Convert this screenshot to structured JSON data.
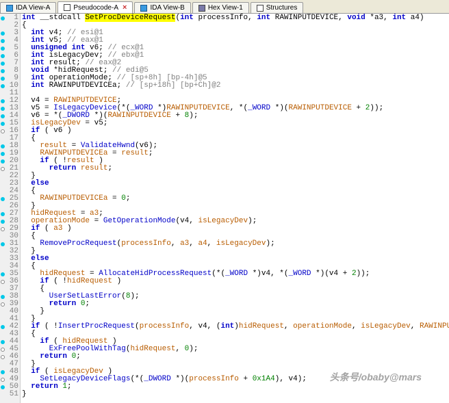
{
  "tabs": [
    {
      "label": "IDA View-A",
      "icon": "ic-square",
      "active": false
    },
    {
      "label": "Pseudocode-A",
      "icon": "ic-box",
      "active": true,
      "closable": true
    },
    {
      "label": "IDA View-B",
      "icon": "ic-square",
      "active": false
    },
    {
      "label": "Hex View-1",
      "icon": "ic-hex",
      "active": false
    },
    {
      "label": "Structures",
      "icon": "ic-struct",
      "active": false
    }
  ],
  "code_lines": [
    {
      "n": 1,
      "b": "cyan",
      "seg": [
        {
          "t": "int",
          "c": "kw"
        },
        {
          "t": " __stdcall "
        },
        {
          "t": "SetProcDeviceRequest",
          "c": "hl"
        },
        {
          "t": "("
        },
        {
          "t": "int",
          "c": "kw"
        },
        {
          "t": " processInfo, "
        },
        {
          "t": "int",
          "c": "kw"
        },
        {
          "t": " RAWINPUTDEVICE, "
        },
        {
          "t": "void",
          "c": "kw"
        },
        {
          "t": " *a3, "
        },
        {
          "t": "int",
          "c": "kw"
        },
        {
          "t": " a4)"
        }
      ]
    },
    {
      "n": 2,
      "seg": [
        {
          "t": "{"
        }
      ]
    },
    {
      "n": 3,
      "b": "cyan",
      "seg": [
        {
          "t": "  "
        },
        {
          "t": "int",
          "c": "kw"
        },
        {
          "t": " v4; "
        },
        {
          "t": "// esi@1",
          "c": "cmt"
        }
      ]
    },
    {
      "n": 4,
      "b": "cyan",
      "seg": [
        {
          "t": "  "
        },
        {
          "t": "int",
          "c": "kw"
        },
        {
          "t": " v5; "
        },
        {
          "t": "// eax@1",
          "c": "cmt"
        }
      ]
    },
    {
      "n": 5,
      "b": "cyan",
      "seg": [
        {
          "t": "  "
        },
        {
          "t": "unsigned",
          "c": "kw"
        },
        {
          "t": " "
        },
        {
          "t": "int",
          "c": "kw"
        },
        {
          "t": " v6; "
        },
        {
          "t": "// ecx@1",
          "c": "cmt"
        }
      ]
    },
    {
      "n": 6,
      "b": "cyan",
      "seg": [
        {
          "t": "  "
        },
        {
          "t": "int",
          "c": "kw"
        },
        {
          "t": " isLegacyDev; "
        },
        {
          "t": "// ebx@1",
          "c": "cmt"
        }
      ]
    },
    {
      "n": 7,
      "b": "cyan",
      "seg": [
        {
          "t": "  "
        },
        {
          "t": "int",
          "c": "kw"
        },
        {
          "t": " result; "
        },
        {
          "t": "// eax@2",
          "c": "cmt"
        }
      ]
    },
    {
      "n": 8,
      "b": "cyan",
      "seg": [
        {
          "t": "  "
        },
        {
          "t": "void",
          "c": "kw"
        },
        {
          "t": " *hidRequest; "
        },
        {
          "t": "// edi@5",
          "c": "cmt"
        }
      ]
    },
    {
      "n": 9,
      "b": "cyan",
      "seg": [
        {
          "t": "  "
        },
        {
          "t": "int",
          "c": "kw"
        },
        {
          "t": " operationMode; "
        },
        {
          "t": "// [sp+8h] [bp-4h]@5",
          "c": "cmt"
        }
      ]
    },
    {
      "n": 10,
      "b": "cyan",
      "seg": [
        {
          "t": "  "
        },
        {
          "t": "int",
          "c": "kw"
        },
        {
          "t": " RAWINPUTDEVICEa; "
        },
        {
          "t": "// [sp+18h] [bp+Ch]@2",
          "c": "cmt"
        }
      ]
    },
    {
      "n": 11,
      "seg": [
        {
          "t": ""
        }
      ]
    },
    {
      "n": 12,
      "b": "cyan",
      "seg": [
        {
          "t": "  v4 = "
        },
        {
          "t": "RAWINPUTDEVICE",
          "c": "id"
        },
        {
          "t": ";"
        }
      ]
    },
    {
      "n": 13,
      "b": "cyan",
      "seg": [
        {
          "t": "  v5 = "
        },
        {
          "t": "IsLegacyDevice",
          "c": "fn"
        },
        {
          "t": "(*("
        },
        {
          "t": "_WORD",
          "c": "ty"
        },
        {
          "t": " *)"
        },
        {
          "t": "RAWINPUTDEVICE",
          "c": "id"
        },
        {
          "t": ", *("
        },
        {
          "t": "_WORD",
          "c": "ty"
        },
        {
          "t": " *)("
        },
        {
          "t": "RAWINPUTDEVICE",
          "c": "id"
        },
        {
          "t": " + "
        },
        {
          "t": "2",
          "c": "num"
        },
        {
          "t": "));"
        }
      ]
    },
    {
      "n": 14,
      "b": "cyan",
      "seg": [
        {
          "t": "  v6 = *("
        },
        {
          "t": "_DWORD",
          "c": "ty"
        },
        {
          "t": " *)("
        },
        {
          "t": "RAWINPUTDEVICE",
          "c": "id"
        },
        {
          "t": " + "
        },
        {
          "t": "8",
          "c": "num"
        },
        {
          "t": ");"
        }
      ]
    },
    {
      "n": 15,
      "b": "cyan",
      "seg": [
        {
          "t": "  "
        },
        {
          "t": "isLegacyDev",
          "c": "id"
        },
        {
          "t": " = v5;"
        }
      ]
    },
    {
      "n": 16,
      "b": "white",
      "seg": [
        {
          "t": "  "
        },
        {
          "t": "if",
          "c": "kw"
        },
        {
          "t": " ( v6 )"
        }
      ]
    },
    {
      "n": 17,
      "seg": [
        {
          "t": "  {"
        }
      ]
    },
    {
      "n": 18,
      "b": "cyan",
      "seg": [
        {
          "t": "    "
        },
        {
          "t": "result",
          "c": "id"
        },
        {
          "t": " = "
        },
        {
          "t": "ValidateHwnd",
          "c": "fn"
        },
        {
          "t": "(v6);"
        }
      ]
    },
    {
      "n": 19,
      "b": "cyan",
      "seg": [
        {
          "t": "    "
        },
        {
          "t": "RAWINPUTDEVICEa",
          "c": "id"
        },
        {
          "t": " = "
        },
        {
          "t": "result",
          "c": "id"
        },
        {
          "t": ";"
        }
      ]
    },
    {
      "n": 20,
      "b": "cyan",
      "seg": [
        {
          "t": "    "
        },
        {
          "t": "if",
          "c": "kw"
        },
        {
          "t": " ( !"
        },
        {
          "t": "result",
          "c": "id"
        },
        {
          "t": " )"
        }
      ]
    },
    {
      "n": 21,
      "b": "white",
      "seg": [
        {
          "t": "      "
        },
        {
          "t": "return",
          "c": "kw"
        },
        {
          "t": " "
        },
        {
          "t": "result",
          "c": "id"
        },
        {
          "t": ";"
        }
      ]
    },
    {
      "n": 22,
      "seg": [
        {
          "t": "  }"
        }
      ]
    },
    {
      "n": 23,
      "seg": [
        {
          "t": "  "
        },
        {
          "t": "else",
          "c": "kw"
        }
      ]
    },
    {
      "n": 24,
      "seg": [
        {
          "t": "  {"
        }
      ]
    },
    {
      "n": 25,
      "b": "cyan",
      "seg": [
        {
          "t": "    "
        },
        {
          "t": "RAWINPUTDEVICEa",
          "c": "id"
        },
        {
          "t": " = "
        },
        {
          "t": "0",
          "c": "num"
        },
        {
          "t": ";"
        }
      ]
    },
    {
      "n": 26,
      "seg": [
        {
          "t": "  }"
        }
      ]
    },
    {
      "n": 27,
      "b": "cyan",
      "seg": [
        {
          "t": "  "
        },
        {
          "t": "hidRequest",
          "c": "id"
        },
        {
          "t": " = "
        },
        {
          "t": "a3",
          "c": "id"
        },
        {
          "t": ";"
        }
      ]
    },
    {
      "n": 28,
      "b": "cyan",
      "seg": [
        {
          "t": "  "
        },
        {
          "t": "operationMode",
          "c": "id"
        },
        {
          "t": " = "
        },
        {
          "t": "GetOperationMode",
          "c": "fn"
        },
        {
          "t": "(v4, "
        },
        {
          "t": "isLegacyDev",
          "c": "id"
        },
        {
          "t": ");"
        }
      ]
    },
    {
      "n": 29,
      "b": "white",
      "seg": [
        {
          "t": "  "
        },
        {
          "t": "if",
          "c": "kw"
        },
        {
          "t": " ( "
        },
        {
          "t": "a3",
          "c": "id"
        },
        {
          "t": " )"
        }
      ]
    },
    {
      "n": 30,
      "seg": [
        {
          "t": "  {"
        }
      ]
    },
    {
      "n": 31,
      "b": "cyan",
      "seg": [
        {
          "t": "    "
        },
        {
          "t": "RemoveProcRequest",
          "c": "fn"
        },
        {
          "t": "("
        },
        {
          "t": "processInfo",
          "c": "id"
        },
        {
          "t": ", "
        },
        {
          "t": "a3",
          "c": "id"
        },
        {
          "t": ", "
        },
        {
          "t": "a4",
          "c": "id"
        },
        {
          "t": ", "
        },
        {
          "t": "isLegacyDev",
          "c": "id"
        },
        {
          "t": ");"
        }
      ]
    },
    {
      "n": 32,
      "seg": [
        {
          "t": "  }"
        }
      ]
    },
    {
      "n": 33,
      "seg": [
        {
          "t": "  "
        },
        {
          "t": "else",
          "c": "kw"
        }
      ]
    },
    {
      "n": 34,
      "seg": [
        {
          "t": "  {"
        }
      ]
    },
    {
      "n": 35,
      "b": "cyan",
      "seg": [
        {
          "t": "    "
        },
        {
          "t": "hidRequest",
          "c": "id"
        },
        {
          "t": " = "
        },
        {
          "t": "AllocateHidProcessRequest",
          "c": "fn"
        },
        {
          "t": "(*("
        },
        {
          "t": "_WORD",
          "c": "ty"
        },
        {
          "t": " *)v4, *("
        },
        {
          "t": "_WORD",
          "c": "ty"
        },
        {
          "t": " *)(v4 + "
        },
        {
          "t": "2",
          "c": "num"
        },
        {
          "t": "));"
        }
      ]
    },
    {
      "n": 36,
      "b": "white",
      "seg": [
        {
          "t": "    "
        },
        {
          "t": "if",
          "c": "kw"
        },
        {
          "t": " ( !"
        },
        {
          "t": "hidRequest",
          "c": "id"
        },
        {
          "t": " )"
        }
      ]
    },
    {
      "n": 37,
      "seg": [
        {
          "t": "    {"
        }
      ]
    },
    {
      "n": 38,
      "b": "cyan",
      "seg": [
        {
          "t": "      "
        },
        {
          "t": "UserSetLastError",
          "c": "fn"
        },
        {
          "t": "("
        },
        {
          "t": "8",
          "c": "num"
        },
        {
          "t": ");"
        }
      ]
    },
    {
      "n": 39,
      "b": "white",
      "seg": [
        {
          "t": "      "
        },
        {
          "t": "return",
          "c": "kw"
        },
        {
          "t": " "
        },
        {
          "t": "0",
          "c": "num"
        },
        {
          "t": ";"
        }
      ]
    },
    {
      "n": 40,
      "seg": [
        {
          "t": "    }"
        }
      ]
    },
    {
      "n": 41,
      "seg": [
        {
          "t": "  }"
        }
      ]
    },
    {
      "n": 42,
      "b": "cyan",
      "seg": [
        {
          "t": "  "
        },
        {
          "t": "if",
          "c": "kw"
        },
        {
          "t": " ( !"
        },
        {
          "t": "InsertProcRequest",
          "c": "fn"
        },
        {
          "t": "("
        },
        {
          "t": "processInfo",
          "c": "id"
        },
        {
          "t": ", v4, ("
        },
        {
          "t": "int",
          "c": "kw"
        },
        {
          "t": ")"
        },
        {
          "t": "hidRequest",
          "c": "id"
        },
        {
          "t": ", "
        },
        {
          "t": "operationMode",
          "c": "id"
        },
        {
          "t": ", "
        },
        {
          "t": "isLegacyDev",
          "c": "id"
        },
        {
          "t": ", "
        },
        {
          "t": "RAWINPUTDEVICEa",
          "c": "id"
        },
        {
          "t": ") )"
        }
      ]
    },
    {
      "n": 43,
      "seg": [
        {
          "t": "  {"
        }
      ]
    },
    {
      "n": 44,
      "b": "cyan",
      "seg": [
        {
          "t": "    "
        },
        {
          "t": "if",
          "c": "kw"
        },
        {
          "t": " ( "
        },
        {
          "t": "hidRequest",
          "c": "id"
        },
        {
          "t": " )"
        }
      ]
    },
    {
      "n": 45,
      "b": "white",
      "seg": [
        {
          "t": "      "
        },
        {
          "t": "ExFreePoolWithTag",
          "c": "fn"
        },
        {
          "t": "("
        },
        {
          "t": "hidRequest",
          "c": "id"
        },
        {
          "t": ", "
        },
        {
          "t": "0",
          "c": "num"
        },
        {
          "t": ");"
        }
      ]
    },
    {
      "n": 46,
      "b": "white",
      "seg": [
        {
          "t": "    "
        },
        {
          "t": "return",
          "c": "kw"
        },
        {
          "t": " "
        },
        {
          "t": "0",
          "c": "num"
        },
        {
          "t": ";"
        }
      ]
    },
    {
      "n": 47,
      "seg": [
        {
          "t": "  }"
        }
      ]
    },
    {
      "n": 48,
      "b": "cyan",
      "seg": [
        {
          "t": "  "
        },
        {
          "t": "if",
          "c": "kw"
        },
        {
          "t": " ( "
        },
        {
          "t": "isLegacyDev",
          "c": "id"
        },
        {
          "t": " )"
        }
      ]
    },
    {
      "n": 49,
      "b": "white",
      "seg": [
        {
          "t": "    "
        },
        {
          "t": "SetLegacyDeviceFlags",
          "c": "fn"
        },
        {
          "t": "(*("
        },
        {
          "t": "_DWORD",
          "c": "ty"
        },
        {
          "t": " *)("
        },
        {
          "t": "processInfo",
          "c": "id"
        },
        {
          "t": " + "
        },
        {
          "t": "0x1A4",
          "c": "num"
        },
        {
          "t": "), v4);"
        }
      ]
    },
    {
      "n": 50,
      "b": "cyan",
      "seg": [
        {
          "t": "  "
        },
        {
          "t": "return",
          "c": "kw"
        },
        {
          "t": " "
        },
        {
          "t": "1",
          "c": "num"
        },
        {
          "t": ";"
        }
      ]
    },
    {
      "n": 51,
      "seg": [
        {
          "t": "}"
        }
      ]
    }
  ],
  "watermark": "头条号/obaby@mars"
}
